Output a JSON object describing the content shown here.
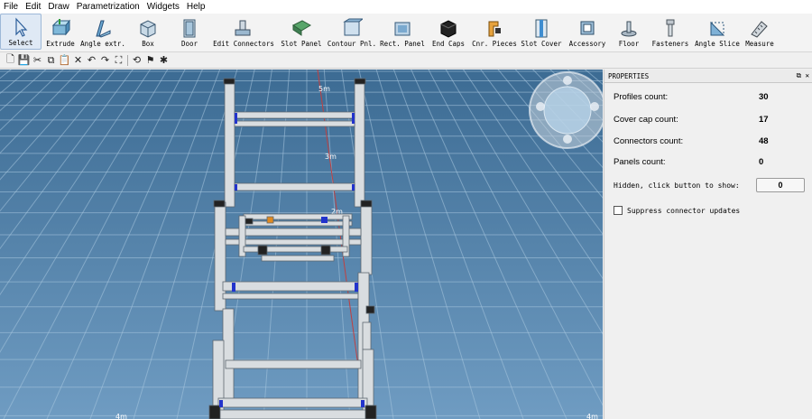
{
  "menu": [
    "File",
    "Edit",
    "Draw",
    "Parametrization",
    "Widgets",
    "Help"
  ],
  "tools": [
    {
      "label": "Select",
      "icon": "cursor-arrow-icon"
    },
    {
      "label": "Extrude",
      "icon": "extrude-icon"
    },
    {
      "label": "Angle extr.",
      "icon": "angle-extrude-icon"
    },
    {
      "label": "Box",
      "icon": "box-icon"
    },
    {
      "label": "Door",
      "icon": "door-icon"
    },
    {
      "label": "Edit Connectors",
      "icon": "edit-connectors-icon"
    },
    {
      "label": "Slot Panel",
      "icon": "slot-panel-icon"
    },
    {
      "label": "Contour Pnl.",
      "icon": "contour-panel-icon"
    },
    {
      "label": "Rect. Panel",
      "icon": "rect-panel-icon"
    },
    {
      "label": "End Caps",
      "icon": "end-caps-icon"
    },
    {
      "label": "Cnr. Pieces",
      "icon": "corner-pieces-icon"
    },
    {
      "label": "Slot Cover",
      "icon": "slot-cover-icon"
    },
    {
      "label": "Accessory",
      "icon": "accessory-icon"
    },
    {
      "label": "Floor",
      "icon": "floor-icon"
    },
    {
      "label": "Fasteners",
      "icon": "fasteners-icon"
    },
    {
      "label": "Angle Slice",
      "icon": "angle-slice-icon"
    },
    {
      "label": "Measure",
      "icon": "measure-icon"
    }
  ],
  "toolbar2": [
    {
      "glyph": "🗋",
      "name": "new-file-icon"
    },
    {
      "glyph": "💾",
      "name": "save-icon"
    },
    {
      "glyph": "✂",
      "name": "cut-icon"
    },
    {
      "glyph": "⧉",
      "name": "copy-icon"
    },
    {
      "glyph": "📋",
      "name": "paste-icon"
    },
    {
      "glyph": "✕",
      "name": "delete-icon"
    },
    {
      "glyph": "↶",
      "name": "undo-icon"
    },
    {
      "glyph": "↷",
      "name": "redo-icon"
    },
    {
      "glyph": "⛶",
      "name": "zoom-extents-icon"
    },
    {
      "glyph": "⟲",
      "name": "rotate-icon"
    },
    {
      "glyph": "⚑",
      "name": "screenshot-icon"
    },
    {
      "glyph": "✱",
      "name": "bug-icon"
    }
  ],
  "viewport": {
    "markers": [
      "5m",
      "3m",
      "2m",
      "4m",
      "4m"
    ]
  },
  "properties": {
    "title": "PROPERTIES",
    "rows": [
      {
        "label": "Profiles count:",
        "value": "30"
      },
      {
        "label": "Cover cap count:",
        "value": "17"
      },
      {
        "label": "Connectors count:",
        "value": "48"
      },
      {
        "label": "Panels count:",
        "value": "0"
      }
    ],
    "hidden_label": "Hidden, click button to show:",
    "hidden_value": "0",
    "suppress_label": "Suppress connector updates"
  }
}
